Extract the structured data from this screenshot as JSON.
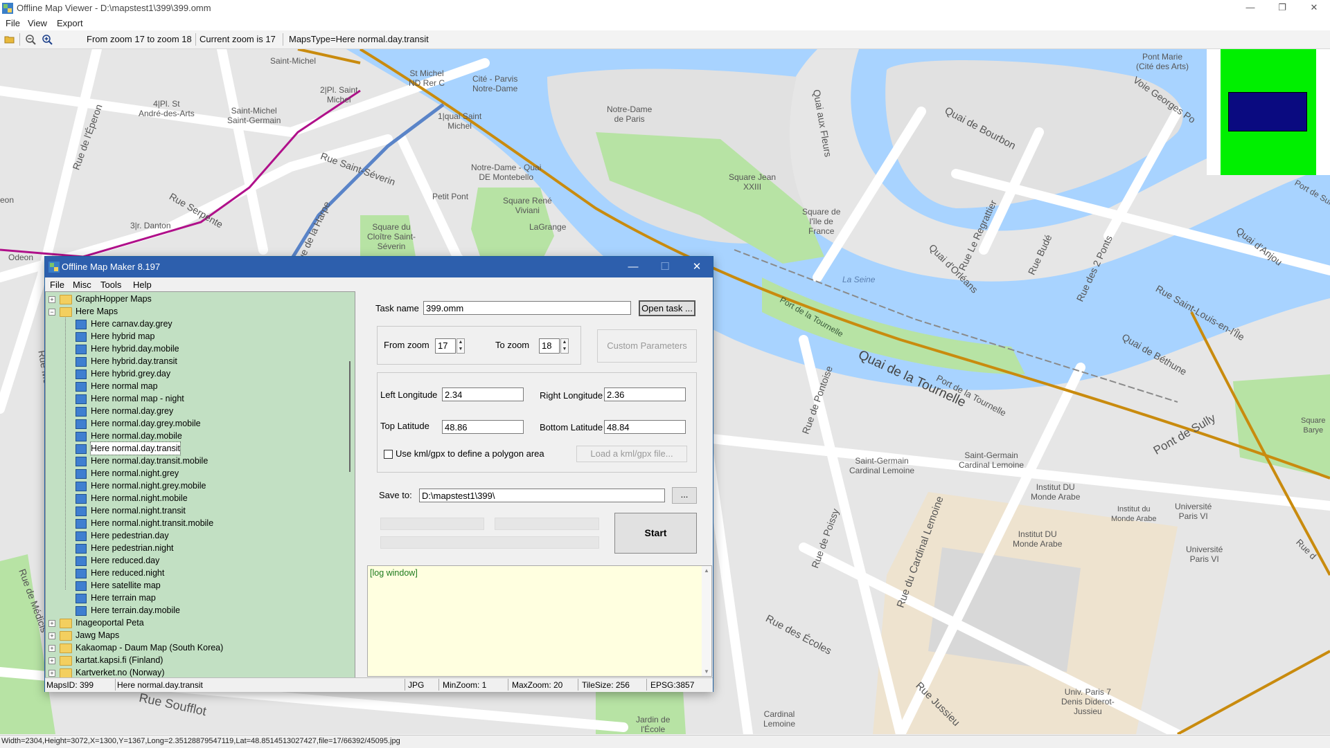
{
  "window": {
    "title": "Offline Map Viewer - D:\\mapstest1\\399\\399.omm",
    "menu": [
      "File",
      "View",
      "Export"
    ]
  },
  "toolbar": {
    "zoom_range": "From zoom 17 to zoom 18",
    "current_zoom": "Current zoom is 17",
    "maps_type": "MapsType=Here normal.day.transit"
  },
  "map": {
    "labels": [
      "Saint-Michel",
      "St Michel\nND Rer C",
      "Cité - Parvis\nNotre-Dame",
      "4|Pl. St\nAndré-des-Arts",
      "2|Pl. Saint\nMichel",
      "Saint-Michel\nSaint-Germain",
      "1|quai Saint\nMichel",
      "Notre-Dame\nde Paris",
      "Notre-Dame - Quai\nDE Montebello",
      "Petit Pont",
      "Square René\nViviani",
      "LaGrange",
      "Square du\nCloître Saint-\nSéverin",
      "3|r. Danton",
      "Square Jean\nXXIII",
      "Square de\nl'île de\nFrance",
      "La Seine",
      "Saint-Germain\nCardinal Lemoine",
      "Saint-Germain\nCardinal Lemoine",
      "Institut DU\nMonde Arabe",
      "Institut du\nMonde Arabe",
      "Institut DU\nMonde Arabe",
      "Université\nParis VI",
      "Université\nParis VI",
      "Univ. Paris 7\nDenis Diderot-\nJussieu",
      "Cardinal\nLemoine",
      "Jardin de\nl'École",
      "Pont Marie\n(Cité des Arts)",
      "Square\nBarye",
      "Odeon",
      "eon"
    ],
    "streets": [
      "Quai de Bourbon",
      "Voie Georges Po",
      "Quai aux Fleurs",
      "Rue Le Regrattier",
      "Quai d'Orléans",
      "Rue Budé",
      "Rue des 2 Ponts",
      "Quai d'Anjou",
      "Rue Saint-Louis-en-l'Île",
      "Quai de Béthune",
      "Port de la Tournelle",
      "Quai de la Tournelle",
      "Port de la Tournelle",
      "Pont de Sully",
      "Rue de Pontoise",
      "Rue de Poissy",
      "Rue du Cardinal Lemoine",
      "Rue des Écoles",
      "Rue Jussieu",
      "Rue Soufflot",
      "Rue de l'Éperon",
      "Rue Serpente",
      "Rue Saint-Séverin",
      "Rue de la Harpe",
      "Rue Monsieur le Prince",
      "Rue de Médicis",
      "Port de Sul",
      "Rue d"
    ]
  },
  "overview_colors": {
    "frame": "#00f000",
    "view": "#0a0a80"
  },
  "statusbar": {
    "text": "Width=2304,Height=3072,X=1300,Y=1367,Long=2.35128879547119,Lat=48.8514513027427,file=17/66392/45095.jpg"
  },
  "dialog": {
    "title": "Offline Map Maker 8.197",
    "menu": [
      "File",
      "Misc",
      "Tools",
      "Help"
    ],
    "tree": {
      "top_before": [
        "GraphHopper Maps"
      ],
      "open_folder": "Here Maps",
      "children": [
        "Here carnav.day.grey",
        "Here hybrid map",
        "Here hybrid.day.mobile",
        "Here hybrid.day.transit",
        "Here hybrid.grey.day",
        "Here normal map",
        "Here normal map - night",
        "Here normal.day.grey",
        "Here normal.day.grey.mobile",
        "Here normal.day.mobile",
        "Here normal.day.transit",
        "Here normal.day.transit.mobile",
        "Here normal.night.grey",
        "Here normal.night.grey.mobile",
        "Here normal.night.mobile",
        "Here normal.night.transit",
        "Here normal.night.transit.mobile",
        "Here pedestrian.day",
        "Here pedestrian.night",
        "Here reduced.day",
        "Here reduced.night",
        "Here satellite map",
        "Here terrain map",
        "Here terrain.day.mobile"
      ],
      "selected": "Here normal.day.transit",
      "top_after": [
        "Inageoportal Peta",
        "Jawg Maps",
        "Kakaomap - Daum Map (South Korea)",
        "kartat.kapsi.fi (Finland)",
        "Kartverket.no (Norway)"
      ]
    },
    "form": {
      "task_name_label": "Task name",
      "task_name_value": "399.omm",
      "open_task_button": "Open task ...",
      "from_zoom_label": "From zoom",
      "from_zoom_value": "17",
      "to_zoom_label": "To zoom",
      "to_zoom_value": "18",
      "custom_params_button": "Custom Parameters",
      "left_lon_label": "Left Longitude",
      "left_lon_value": "2.34",
      "right_lon_label": "Right Longitude",
      "right_lon_value": "2.36",
      "top_lat_label": "Top Latitude",
      "top_lat_value": "48.86",
      "bottom_lat_label": "Bottom Latitude",
      "bottom_lat_value": "48.84",
      "polygon_checkbox_label": "Use kml/gpx to define a polygon area",
      "load_kml_button": "Load a kml/gpx file...",
      "save_to_label": "Save to:",
      "save_to_value": "D:\\mapstest1\\399\\",
      "browse_button": "...",
      "start_button": "Start",
      "log_text": "[log window]"
    },
    "status": {
      "maps_id": "MapsID: 399",
      "maps_name": "Here normal.day.transit",
      "format": "JPG",
      "min_zoom": "MinZoom: 1",
      "max_zoom": "MaxZoom: 20",
      "tile_size": "TileSize: 256",
      "epsg": "EPSG:3857"
    }
  }
}
